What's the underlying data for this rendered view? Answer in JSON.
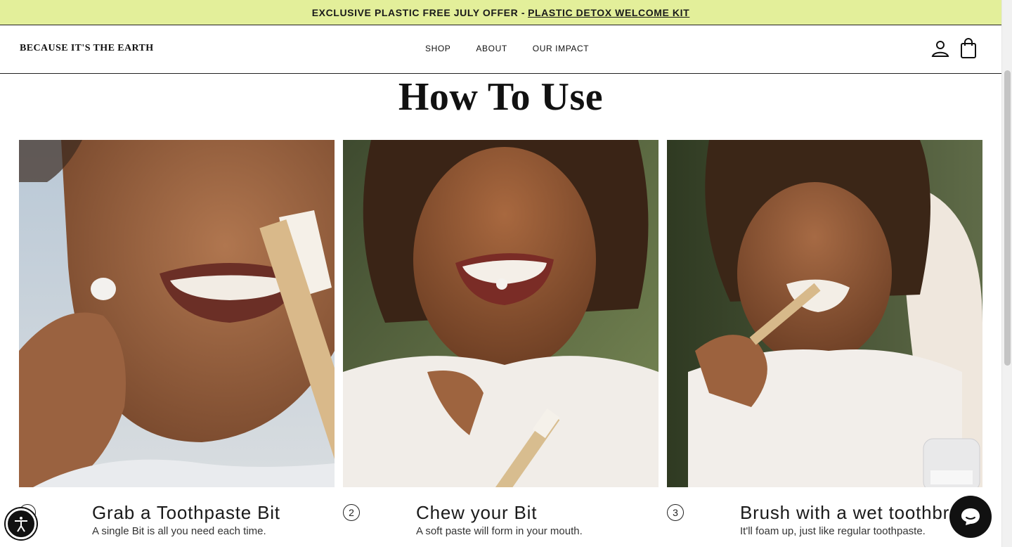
{
  "announcement": {
    "text": "EXCLUSIVE PLASTIC FREE JULY OFFER -",
    "link_label": "PLASTIC DETOX WELCOME KIT"
  },
  "header": {
    "brand": "BECAUSE IT'S THE EARTH",
    "nav": [
      {
        "label": "SHOP"
      },
      {
        "label": "ABOUT"
      },
      {
        "label": "OUR IMPACT"
      }
    ],
    "icons": {
      "account": "user-icon",
      "cart": "shopping-bag-icon"
    }
  },
  "section": {
    "title": "How To Use"
  },
  "steps": [
    {
      "number": "1",
      "title": "Grab a Toothpaste Bit",
      "description": "A single Bit is all you need each time."
    },
    {
      "number": "2",
      "title": "Chew your Bit",
      "description": "A soft paste will form in your mouth."
    },
    {
      "number": "3",
      "title": "Brush with a wet toothbrush",
      "description": "It'll foam up, just like regular toothpaste."
    }
  ],
  "widgets": {
    "accessibility": "accessibility-icon",
    "chat": "chat-icon"
  },
  "colors": {
    "announcement_bg": "#e3ef9a",
    "text": "#111111",
    "widget_bg": "#111111"
  }
}
